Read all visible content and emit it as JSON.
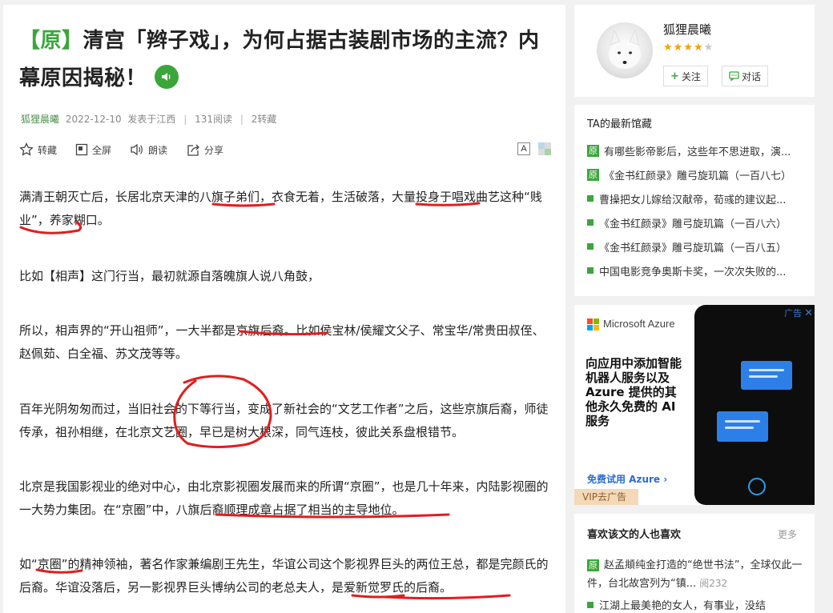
{
  "article": {
    "title_tag": "【原】",
    "title_text": "清宫「辫子戏」，为何占据古装剧市场的主流？内幕原因揭秘！",
    "meta": {
      "author": "狐狸晨曦",
      "date": "2022-12-10",
      "location": "发表于江西",
      "reads": "131阅读",
      "reposts": "2转藏"
    },
    "toolbar": {
      "collect": "转藏",
      "fullscreen": "全屏",
      "read_aloud": "朗读",
      "share": "分享",
      "font_size": "A"
    },
    "paragraphs": [
      "满清王朝灭亡后，长居北京天津的八旗子弟们，衣食无着，生活破落，大量投身于唱戏曲艺这种“贱业”，养家糊口。",
      "比如【相声】这门行当，最初就源自落魄旗人说八角鼓，",
      "所以，相声界的“开山祖师”，一大半都是京旗后裔。比如侯宝林/侯耀文父子、常宝华/常贵田叔侄、赵佩茹、白全福、苏文茂等等。",
      "百年光阴匆匆而过，当旧社会的下等行当，变成了新社会的“文艺工作者”之后，这些京旗后裔，师徒传承，祖孙相继，在北京文艺圈，早已是树大根深，同气连枝，彼此关系盘根错节。",
      "北京是我国影视业的绝对中心，由北京影视圈发展而来的所谓“京圈”，也是几十年来，内陆影视圈的一大势力集团。在“京圈”中，八旗后裔顺理成章占据了相当的主导地位。",
      "如“京圈”的精神领袖，著名作家兼编剧王先生，华谊公司这个影视界巨头的两位王总，都是完颜氏的后裔。华谊没落后，另一影视界巨头博纳公司的老总夫人，是爱新觉罗氏的后裔。"
    ]
  },
  "profile": {
    "name": "狐狸晨曦",
    "rating": 4.5,
    "follow": "关注",
    "chat": "对话",
    "follow_icon": "+",
    "chat_icon": "chat-icon"
  },
  "latest": {
    "title": "TA的最新馆藏",
    "items": [
      {
        "badge": "原",
        "text": "有哪些影帝影后，这些年不思进取，演..."
      },
      {
        "badge": "原",
        "text": "《金书红颜录》雕弓旋玑篇（一百八七）"
      },
      {
        "badge": "",
        "text": "曹操把女儿嫁给汉献帝，荀彧的建议起..."
      },
      {
        "badge": "",
        "text": "《金书红颜录》雕弓旋玑篇（一百八六）"
      },
      {
        "badge": "",
        "text": "《金书红颜录》雕弓旋玑篇（一百八五）"
      },
      {
        "badge": "",
        "text": "中国电影竞争奥斯卡奖，一次次失败的..."
      }
    ]
  },
  "ad": {
    "close_label": "广告",
    "brand": "Microsoft Azure",
    "headline": "向应用中添加智能机器人服务以及 Azure 提供的其他永久免费的 AI 服务",
    "cta": "免费试用 Azure ›",
    "vip": "VIP去广告",
    "colors": {
      "ms_red": "#f25022",
      "ms_green": "#7fba00",
      "ms_blue": "#00a4ef",
      "ms_yellow": "#ffb900"
    }
  },
  "recommend": {
    "title": "喜欢该文的人也喜欢",
    "more": "更多",
    "items": [
      {
        "badge": "原",
        "text": "赵孟頫纯金打造的“绝世书法”，全球仅此一件，台北故宫列为“镇...",
        "reads": "阅232"
      },
      {
        "badge": "",
        "text": "江湖上最美艳的女人，有事业，没结"
      }
    ]
  },
  "colors": {
    "accent": "#3aa63a",
    "scribble": "#e01e1e"
  }
}
